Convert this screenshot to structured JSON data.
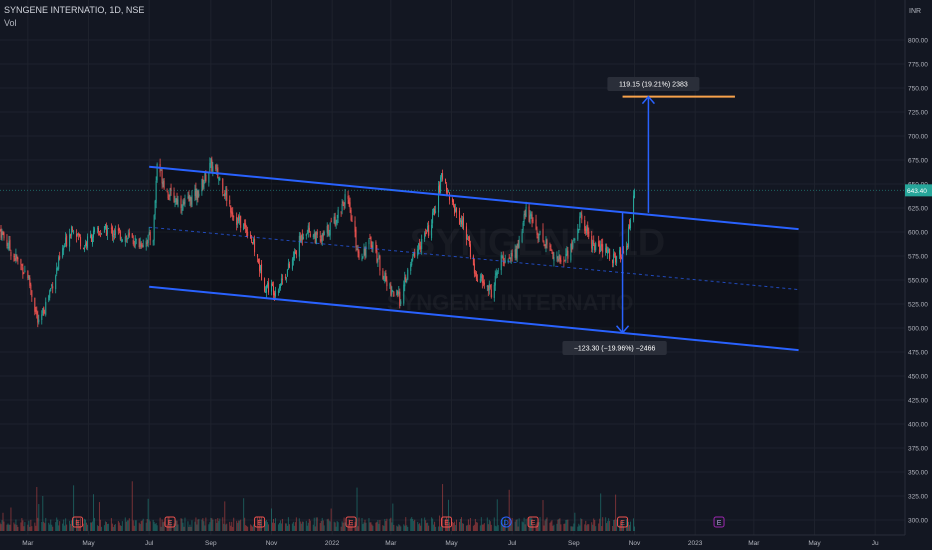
{
  "header": {
    "title": "SYNGENE INTERNATIO, 1D, NSE",
    "volume_label": "Vol"
  },
  "watermark": {
    "symbol": "SYNGENE, 1D",
    "name": "SYNGENE INTERNATIO"
  },
  "price_axis": {
    "currency": "INR",
    "current_price_label": "643.40",
    "current_price": 643.4
  },
  "measurements": {
    "up_label": "119.15 (19.21%) 2383",
    "down_label": "−123.30 (−19.96%) −2466"
  },
  "colors": {
    "background": "#131722",
    "up_candle": "#26a69a",
    "down_candle": "#ef5350",
    "channel_line": "#2962ff",
    "target_line": "#f7a24b",
    "last_price_badge": "#26a69a",
    "axis_text": "#b2b5be"
  },
  "chart_data": {
    "type": "candlestick",
    "symbol": "SYNGENE INTERNATIO",
    "interval": "1D",
    "exchange": "NSE",
    "y_axis": {
      "unit": "INR",
      "range": [
        290,
        812
      ],
      "price_pane_ticks": [
        800,
        775,
        750,
        725,
        700,
        675,
        650,
        625,
        600,
        575,
        550,
        525,
        500,
        475,
        450,
        425
      ],
      "volume_pane_ticks": [
        400,
        375,
        350,
        325,
        300
      ],
      "tick_labels": [
        "800.00",
        "775.00",
        "750.00",
        "725.00",
        "700.00",
        "675.00",
        "650.00",
        "625.00",
        "600.00",
        "575.00",
        "550.00",
        "525.00",
        "500.00",
        "475.00",
        "450.00",
        "425.00",
        "400.00",
        "375.00",
        "350.00",
        "325.00",
        "300.00"
      ]
    },
    "x_axis": {
      "labels": [
        "Mar",
        "May",
        "Jul",
        "Sep",
        "Nov",
        "2022",
        "Mar",
        "May",
        "Jul",
        "Sep",
        "Nov",
        "2023",
        "Mar",
        "May",
        "Ju"
      ],
      "label_dates": [
        "2021-03",
        "2021-05",
        "2021-07",
        "2021-09",
        "2021-11",
        "2022-01",
        "2022-03",
        "2022-05",
        "2022-07",
        "2022-09",
        "2022-11",
        "2023-01",
        "2023-03",
        "2023-05",
        "2023-07"
      ],
      "range": [
        "2021-02-01",
        "2023-07-31"
      ]
    },
    "price_anchors": [
      {
        "date": "2021-02-01",
        "price": 602
      },
      {
        "date": "2021-02-15",
        "price": 575
      },
      {
        "date": "2021-03-01",
        "price": 555
      },
      {
        "date": "2021-03-12",
        "price": 502
      },
      {
        "date": "2021-03-22",
        "price": 535
      },
      {
        "date": "2021-04-05",
        "price": 580
      },
      {
        "date": "2021-04-15",
        "price": 608
      },
      {
        "date": "2021-04-26",
        "price": 585
      },
      {
        "date": "2021-05-05",
        "price": 597
      },
      {
        "date": "2021-05-20",
        "price": 602
      },
      {
        "date": "2021-06-05",
        "price": 596
      },
      {
        "date": "2021-06-20",
        "price": 588
      },
      {
        "date": "2021-07-05",
        "price": 595
      },
      {
        "date": "2021-07-09",
        "price": 672
      },
      {
        "date": "2021-07-20",
        "price": 640
      },
      {
        "date": "2021-08-05",
        "price": 628
      },
      {
        "date": "2021-08-20",
        "price": 642
      },
      {
        "date": "2021-09-01",
        "price": 670
      },
      {
        "date": "2021-09-10",
        "price": 655
      },
      {
        "date": "2021-09-25",
        "price": 615
      },
      {
        "date": "2021-10-10",
        "price": 600
      },
      {
        "date": "2021-10-25",
        "price": 545
      },
      {
        "date": "2021-11-05",
        "price": 540
      },
      {
        "date": "2021-11-20",
        "price": 565
      },
      {
        "date": "2021-12-05",
        "price": 605
      },
      {
        "date": "2021-12-20",
        "price": 590
      },
      {
        "date": "2022-01-05",
        "price": 615
      },
      {
        "date": "2022-01-15",
        "price": 638
      },
      {
        "date": "2022-01-28",
        "price": 575
      },
      {
        "date": "2022-02-10",
        "price": 590
      },
      {
        "date": "2022-02-25",
        "price": 545
      },
      {
        "date": "2022-03-10",
        "price": 530
      },
      {
        "date": "2022-03-25",
        "price": 578
      },
      {
        "date": "2022-04-10",
        "price": 605
      },
      {
        "date": "2022-04-22",
        "price": 660
      },
      {
        "date": "2022-05-02",
        "price": 628
      },
      {
        "date": "2022-05-15",
        "price": 603
      },
      {
        "date": "2022-05-25",
        "price": 555
      },
      {
        "date": "2022-06-10",
        "price": 538
      },
      {
        "date": "2022-06-20",
        "price": 570
      },
      {
        "date": "2022-07-05",
        "price": 578
      },
      {
        "date": "2022-07-15",
        "price": 622
      },
      {
        "date": "2022-07-28",
        "price": 598
      },
      {
        "date": "2022-08-10",
        "price": 580
      },
      {
        "date": "2022-08-20",
        "price": 567
      },
      {
        "date": "2022-09-01",
        "price": 590
      },
      {
        "date": "2022-09-08",
        "price": 615
      },
      {
        "date": "2022-09-20",
        "price": 587
      },
      {
        "date": "2022-10-05",
        "price": 578
      },
      {
        "date": "2022-10-15",
        "price": 570
      },
      {
        "date": "2022-10-25",
        "price": 592
      },
      {
        "date": "2022-11-01",
        "price": 643.4
      }
    ],
    "drawings": {
      "channel_upper": [
        {
          "date": "2021-07-01",
          "price": 668
        },
        {
          "date": "2023-04-15",
          "price": 603
        }
      ],
      "channel_lower": [
        {
          "date": "2021-07-01",
          "price": 543
        },
        {
          "date": "2023-04-15",
          "price": 477
        }
      ],
      "channel_midline": [
        {
          "date": "2021-07-01",
          "price": 605
        },
        {
          "date": "2023-04-15",
          "price": 540
        }
      ],
      "target_line": {
        "from": "2022-10-20",
        "to": "2023-02-10",
        "price": 741
      },
      "up_measure": {
        "date": "2022-11-15",
        "from": 620,
        "to": 741,
        "change": 119.15,
        "change_pct": 19.21,
        "ticks": 2383
      },
      "down_measure": {
        "date": "2022-10-20",
        "from": 620,
        "to": 495,
        "change": -123.3,
        "change_pct": -19.96,
        "ticks": -2466
      }
    },
    "earnings_markers": [
      "2021-04-20",
      "2021-07-22",
      "2021-10-20",
      "2022-01-20",
      "2022-04-26",
      "2022-07-22",
      "2022-10-20",
      "2023-01-25"
    ],
    "dividend_markers": [
      "2022-06-25"
    ],
    "volume_note": "Volume histogram drawn in the lower pane, scaled independently of the price axis"
  }
}
